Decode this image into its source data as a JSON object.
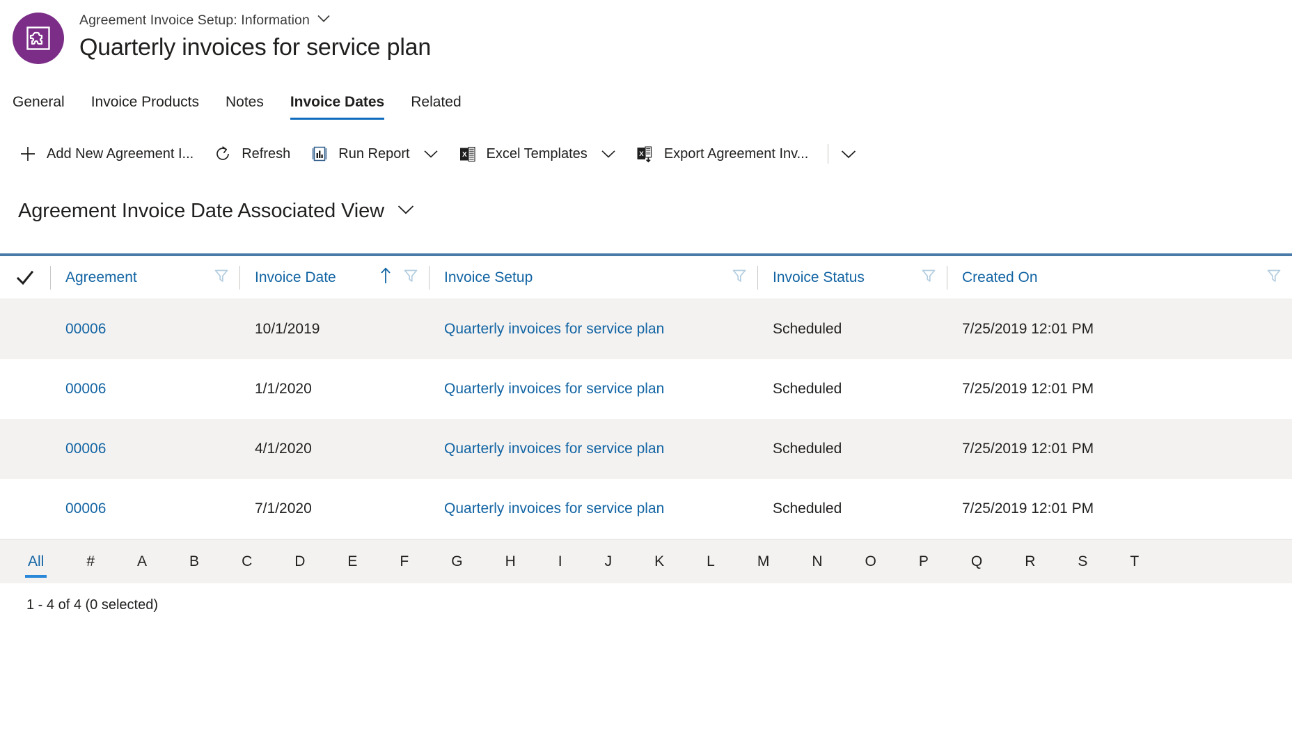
{
  "header": {
    "breadcrumb": "Agreement Invoice Setup: Information",
    "record_title": "Quarterly invoices for service plan",
    "avatar_icon": "entity-puzzle-icon",
    "avatar_color": "#7b2d87",
    "breadcrumb_caret_icon": "chevron-down-icon"
  },
  "tabs": [
    {
      "label": "General",
      "active": false
    },
    {
      "label": "Invoice Products",
      "active": false
    },
    {
      "label": "Notes",
      "active": false
    },
    {
      "label": "Invoice Dates",
      "active": true
    },
    {
      "label": "Related",
      "active": false
    }
  ],
  "commandbar": {
    "items": [
      {
        "label": "Add New Agreement I...",
        "icon": "plus-icon",
        "caret": false
      },
      {
        "label": "Refresh",
        "icon": "refresh-icon",
        "caret": false
      },
      {
        "label": "Run Report",
        "icon": "report-chart-icon",
        "caret": true
      },
      {
        "label": "Excel Templates",
        "icon": "excel-icon",
        "caret": true
      },
      {
        "label": "Export Agreement Inv...",
        "icon": "excel-export-icon",
        "caret": false
      }
    ],
    "overflow_icon": "chevron-down-icon"
  },
  "view_selector": {
    "title": "Agreement Invoice Date Associated View",
    "caret_icon": "chevron-down-icon"
  },
  "grid": {
    "select_all_icon": "checkmark-icon",
    "sort_asc_icon": "arrow-up-icon",
    "filter_icon": "filter-funnel-icon",
    "columns": [
      {
        "label": "Agreement",
        "filter": true,
        "sorted": false
      },
      {
        "label": "Invoice Date",
        "filter": true,
        "sorted": true
      },
      {
        "label": "Invoice Setup",
        "filter": true,
        "sorted": false
      },
      {
        "label": "Invoice Status",
        "filter": true,
        "sorted": false
      },
      {
        "label": "Created On",
        "filter": true,
        "sorted": false
      }
    ],
    "rows": [
      {
        "agreement": "00006",
        "invoice_date": "10/1/2019",
        "invoice_setup": "Quarterly invoices for service plan",
        "invoice_status": "Scheduled",
        "created_on": "7/25/2019 12:01 PM"
      },
      {
        "agreement": "00006",
        "invoice_date": "1/1/2020",
        "invoice_setup": "Quarterly invoices for service plan",
        "invoice_status": "Scheduled",
        "created_on": "7/25/2019 12:01 PM"
      },
      {
        "agreement": "00006",
        "invoice_date": "4/1/2020",
        "invoice_setup": "Quarterly invoices for service plan",
        "invoice_status": "Scheduled",
        "created_on": "7/25/2019 12:01 PM"
      },
      {
        "agreement": "00006",
        "invoice_date": "7/1/2020",
        "invoice_setup": "Quarterly invoices for service plan",
        "invoice_status": "Scheduled",
        "created_on": "7/25/2019 12:01 PM"
      }
    ]
  },
  "alpha_filter": {
    "selected": "All",
    "items": [
      "All",
      "#",
      "A",
      "B",
      "C",
      "D",
      "E",
      "F",
      "G",
      "H",
      "I",
      "J",
      "K",
      "L",
      "M",
      "N",
      "O",
      "P",
      "Q",
      "R",
      "S",
      "T"
    ]
  },
  "footer": {
    "status": "1 - 4 of 4 (0 selected)"
  },
  "colors": {
    "accent_blue": "#0f6cbd",
    "link_blue": "#1264a3",
    "grid_top_border": "#4a7ba8",
    "row_alt": "#f3f2f1",
    "avatar_purple": "#7b2d87"
  }
}
